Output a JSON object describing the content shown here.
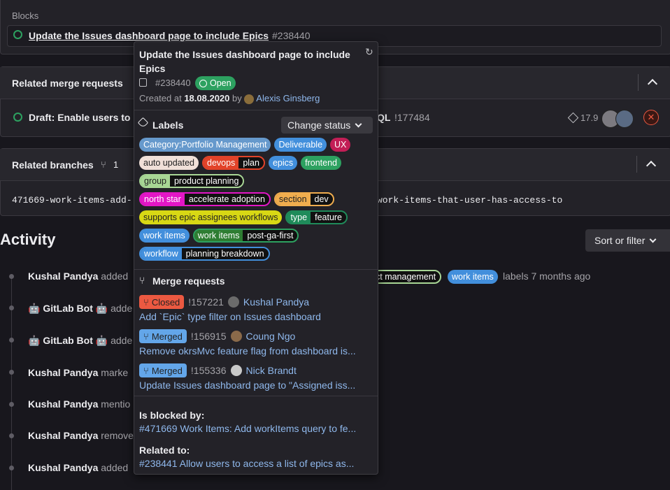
{
  "blocks": {
    "heading": "Blocks",
    "item_title": "Update the Issues dashboard page to include Epics",
    "item_ref": "#238440"
  },
  "related_mrs": {
    "heading": "Related merge requests",
    "item_title_left": "Draft: Enable users to",
    "item_title_right": "QL",
    "item_ref": "!177484",
    "weight": "17.9"
  },
  "related_branches": {
    "heading": "Related branches",
    "count": "1",
    "branch_left": "471669-work-items-add-",
    "branch_right": "work-items-that-user-has-access-to"
  },
  "activity": {
    "heading": "Activity",
    "sort_label": "Sort or filter",
    "rows": [
      {
        "author": "Kushal Pandya",
        "action": "added"
      },
      {
        "author": "GitLab Bot",
        "action": "adde"
      },
      {
        "author": "GitLab Bot",
        "action": "adde"
      },
      {
        "author": "Kushal Pandya",
        "action": "marke"
      },
      {
        "author": "Kushal Pandya",
        "action": "mentio"
      },
      {
        "author": "Kushal Pandya",
        "action": "remove"
      },
      {
        "author": "Kushal Pandya",
        "action": "added"
      }
    ],
    "row1_label_a": "ct management",
    "row1_label_b": "work items",
    "row1_tail": "labels 7 months ago"
  },
  "popover": {
    "title": "Update the Issues dashboard page to include Epics",
    "ref": "#238440",
    "status": "Open",
    "created_prefix": "Created at",
    "created_date": "18.08.2020",
    "created_by": "by",
    "author": "Alexis Ginsberg",
    "labels_heading": "Labels",
    "change_status": "Change status",
    "labels": {
      "category": "Category:Portfolio Management",
      "deliverable": "Deliverable",
      "ux": "UX",
      "auto_updated": "auto updated",
      "devops_k": "devops",
      "devops_v": "plan",
      "epics": "epics",
      "frontend": "frontend",
      "group_k": "group",
      "group_v": "product planning",
      "north_k": "north star",
      "north_v": "accelerate adoption",
      "section_k": "section",
      "section_v": "dev",
      "supports": "supports epic assignees workflows",
      "type_k": "type",
      "type_v": "feature",
      "work_items": "work items",
      "wi_k": "work items",
      "wi_v": "post-ga-first",
      "workflow_k": "workflow",
      "workflow_v": "planning breakdown"
    },
    "mr_heading": "Merge requests",
    "mrs": [
      {
        "status": "Closed",
        "ref": "!157221",
        "author": "Kushal Pandya",
        "title": "Add `Epic` type filter on Issues dashboard"
      },
      {
        "status": "Merged",
        "ref": "!156915",
        "author": "Coung Ngo",
        "title": "Remove okrsMvc feature flag from dashboard is..."
      },
      {
        "status": "Merged",
        "ref": "!155336",
        "author": "Nick Brandt",
        "title": "Update Issues dashboard page to \"Assigned iss..."
      }
    ],
    "blocked_heading": "Is blocked by:",
    "blocked_item": "#471669 Work Items: Add workItems query to fe...",
    "related_heading": "Related to:",
    "related_item": "#238441 Allow users to access a list of epics as..."
  },
  "colors": {
    "open_green": "#2da160",
    "closed_red": "#ec5941",
    "merged_blue": "#428fdc",
    "link_blue": "#8fb8ec"
  }
}
